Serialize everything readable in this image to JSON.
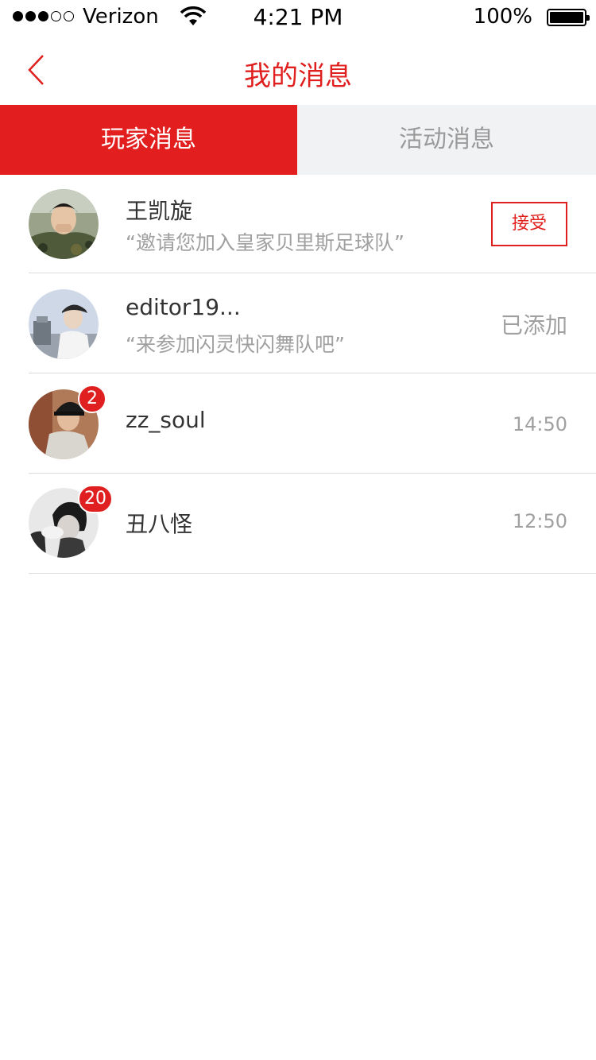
{
  "status_bar": {
    "carrier": "Verizon",
    "time": "4:21 PM",
    "battery": "100%"
  },
  "nav": {
    "title": "我的消息",
    "back_icon": "chevron-left-icon"
  },
  "tabs": [
    {
      "label": "玩家消息",
      "active": true
    },
    {
      "label": "活动消息",
      "active": false
    }
  ],
  "messages": [
    {
      "name": "王凯旋",
      "message": "“邀请您加入皇家贝里斯足球队”",
      "action": "接受"
    },
    {
      "name": "editor19...",
      "message": "“来参加闪灵快闪舞队吧”",
      "status": "已添加"
    },
    {
      "name": "zz_soul",
      "time": "14:50",
      "badge": "2"
    },
    {
      "name": "丑八怪",
      "time": "12:50",
      "badge": "20"
    }
  ],
  "colors": {
    "accent": "#e21e1e",
    "tab_inactive_bg": "#f1f2f4",
    "muted_text": "#a0a0a0"
  }
}
